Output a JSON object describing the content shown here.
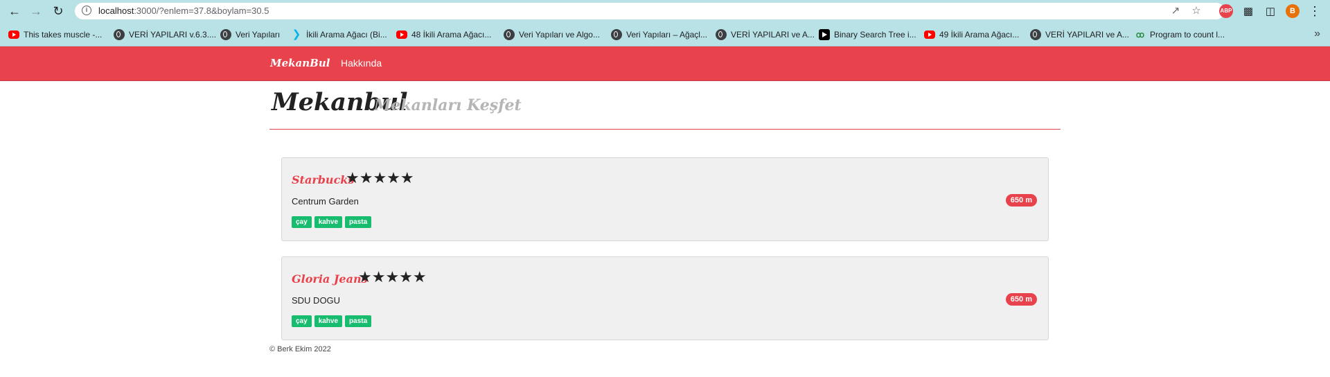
{
  "browser": {
    "url_host": "localhost",
    "url_rest": ":3000/?enlem=37.8&boylam=30.5",
    "profile_initial": "B",
    "abp_label": "ABP",
    "bookmarks": [
      {
        "label": "This takes muscle -...",
        "icon": "youtube-icon"
      },
      {
        "label": "VERİ YAPILARI v.6.3....",
        "icon": "globe-icon"
      },
      {
        "label": "Veri Yapıları",
        "icon": "globe-icon"
      },
      {
        "label": "İkili Arama Ağacı (Bi...",
        "icon": "flutter-icon"
      },
      {
        "label": "48 İkili Arama Ağacı...",
        "icon": "youtube-icon"
      },
      {
        "label": "Veri Yapıları ve Algo...",
        "icon": "globe-icon"
      },
      {
        "label": "Veri Yapıları – Ağaçl...",
        "icon": "globe-icon"
      },
      {
        "label": "VERİ YAPILARI ve A...",
        "icon": "globe-icon"
      },
      {
        "label": "Binary Search Tree i...",
        "icon": "play-icon"
      },
      {
        "label": "49 İkili Arama Ağacı...",
        "icon": "youtube-icon"
      },
      {
        "label": "VERİ YAPILARI ve A...",
        "icon": "globe-icon"
      },
      {
        "label": "Program to count l...",
        "icon": "gfg-icon"
      }
    ],
    "more_label": "»"
  },
  "site": {
    "brand": "MekanBul",
    "nav_about": "Hakkında",
    "title": "Mekanbul",
    "subtitle": "Mekanları Keşfet",
    "footer": "© Berk Ekim 2022"
  },
  "places": [
    {
      "name": "Starbucks",
      "stars": "★★★★★",
      "rating": 5,
      "address": "Centrum Garden",
      "distance": "650 m",
      "tags": [
        "çay",
        "kahve",
        "pasta"
      ]
    },
    {
      "name": "Gloria Jeans",
      "stars": "★★★★★",
      "rating": 5,
      "address": "SDU DOGU",
      "distance": "650 m",
      "tags": [
        "çay",
        "kahve",
        "pasta"
      ]
    }
  ],
  "colors": {
    "accent": "#e8434c",
    "tag": "#18bc6e",
    "chrome": "#b9e2e6"
  }
}
